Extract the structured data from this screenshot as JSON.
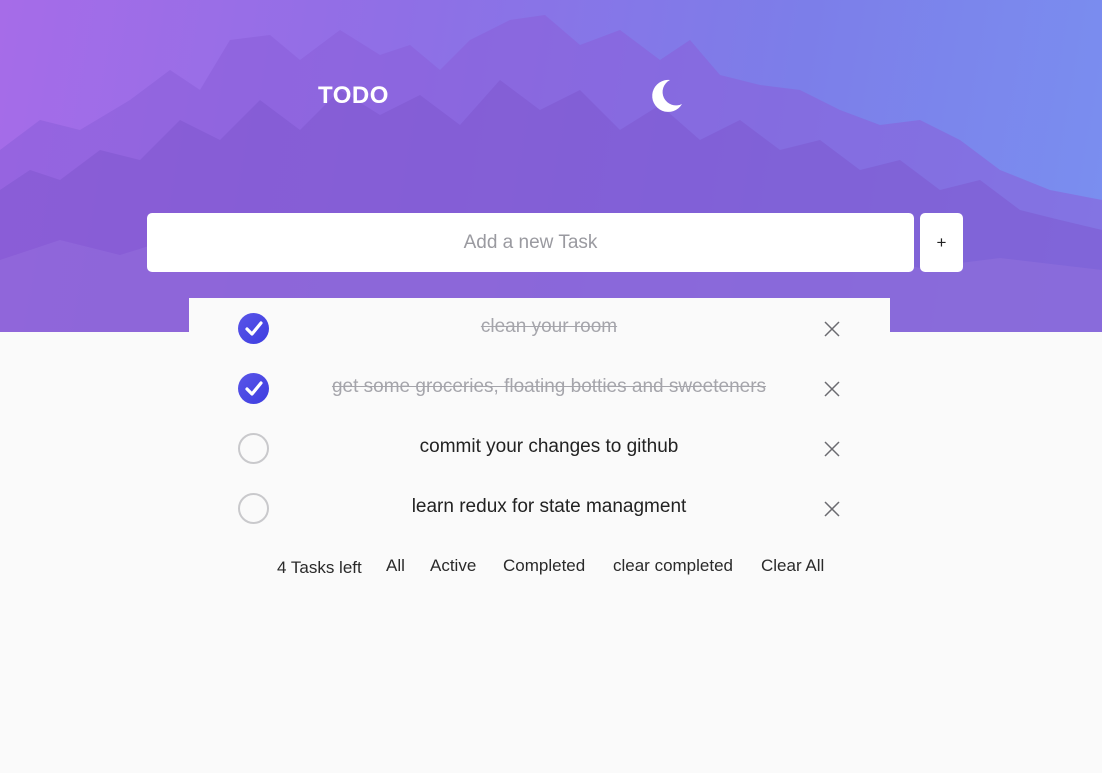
{
  "header": {
    "title": "TODO",
    "theme_icon": "moon-icon"
  },
  "new_task": {
    "placeholder": "Add a new Task",
    "value": "",
    "add_label": "+"
  },
  "tasks": [
    {
      "text": "clean your room",
      "completed": true
    },
    {
      "text": "get some groceries, floating botties and sweeteners",
      "completed": true
    },
    {
      "text": "commit your changes to github",
      "completed": false
    },
    {
      "text": "learn redux for state managment",
      "completed": false
    }
  ],
  "footer": {
    "tasks_left": "4 Tasks left",
    "filter_all": "All",
    "filter_active": "Active",
    "filter_completed": "Completed",
    "clear_completed": "clear completed",
    "clear_all": "Clear All"
  },
  "colors": {
    "accent": "#4a47e4",
    "hero_start": "#a66ce8",
    "hero_end": "#7a8ff0",
    "background": "#fafafa"
  }
}
